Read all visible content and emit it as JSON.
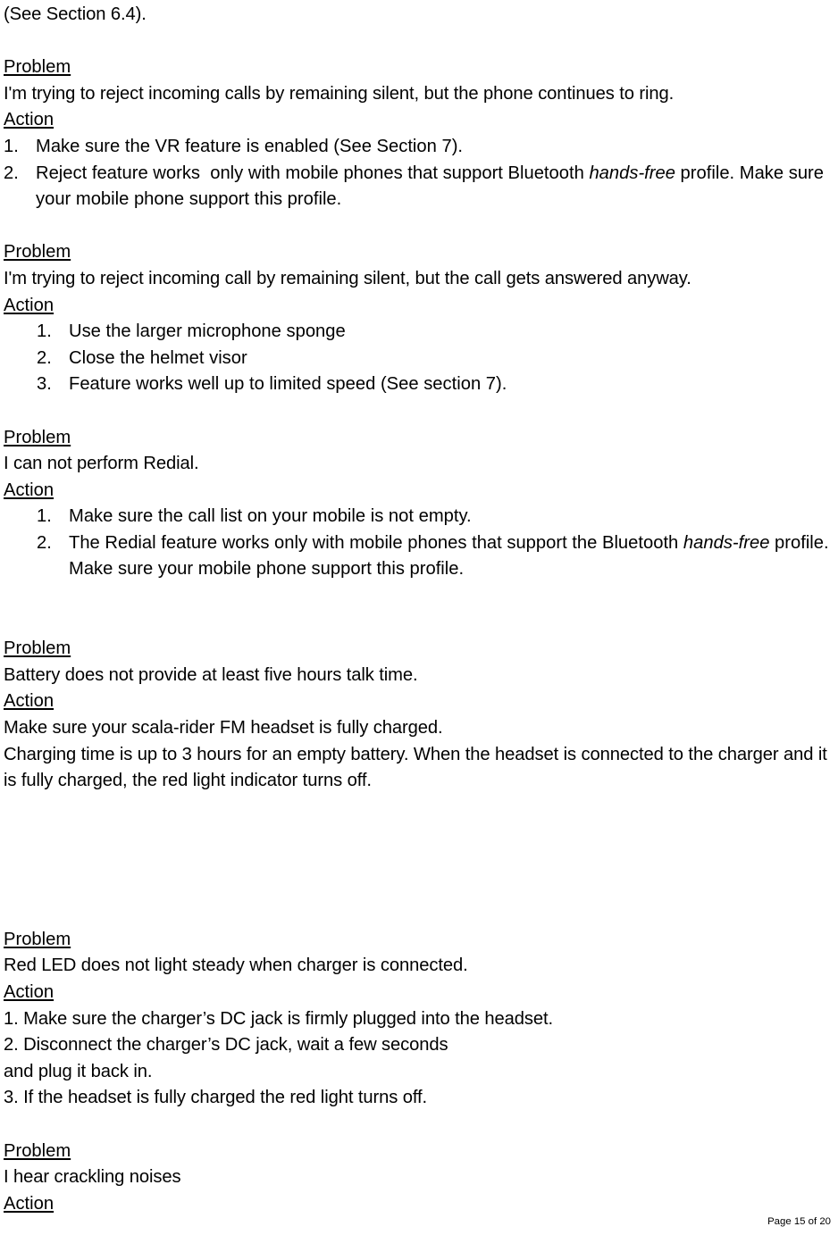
{
  "document": {
    "intro_line": "(See Section 6.4).",
    "labels": {
      "problem": "Problem",
      "action": "Action"
    },
    "sections": [
      {
        "problem_label": "Problem",
        "problem_text": "I'm trying to reject incoming calls by remaining silent, but the phone continues to ring.",
        "action_label": "Action",
        "items": [
          {
            "num": "1.",
            "text_before": "Make sure the VR feature is enabled (See Section 7).",
            "italic": "",
            "text_after": ""
          },
          {
            "num": "2.",
            "text_before": "Reject feature works  only with mobile phones that support Bluetooth ",
            "italic": "hands-free",
            "text_after": " profile. Make sure your mobile phone support this profile."
          }
        ]
      },
      {
        "problem_label": "Problem",
        "problem_text": "I'm trying to reject incoming call by remaining silent, but the call gets answered anyway.",
        "action_label": "Action",
        "items": [
          {
            "num": "1.",
            "text_before": "Use the larger microphone sponge",
            "italic": "",
            "text_after": ""
          },
          {
            "num": "2.",
            "text_before": "Close the helmet visor",
            "italic": "",
            "text_after": ""
          },
          {
            "num": "3.",
            "text_before": "Feature works well up to limited speed (See section 7).",
            "italic": "",
            "text_after": ""
          }
        ]
      },
      {
        "problem_label": "Problem",
        "problem_text": "I can not perform Redial.",
        "action_label": "Action",
        "items": [
          {
            "num": "1.",
            "text_before": "Make sure the call list on your mobile is not empty.",
            "italic": "",
            "text_after": ""
          },
          {
            "num": "2.",
            "text_before": "The Redial feature works only with mobile phones that support the Bluetooth ",
            "italic": "hands-free",
            "text_after": " profile. Make sure your mobile phone support this profile."
          }
        ]
      },
      {
        "problem_label": "Problem",
        "problem_text": "Battery does not provide at least five hours talk time.",
        "action_label": "Action",
        "action_lines": [
          "Make sure your scala-rider FM headset is fully charged.",
          "Charging time is up to 3 hours for an empty battery. When the headset is connected to the charger and it is fully charged, the red light indicator turns off."
        ]
      },
      {
        "problem_label": "Problem",
        "problem_text": "Red LED does not light steady when charger is connected.",
        "action_label": "Action",
        "action_lines": [
          "1. Make sure the charger’s DC jack is firmly plugged into the headset.",
          "2. Disconnect the charger’s DC jack, wait a few seconds",
          "and plug it back in.",
          "3. If the headset is fully charged the red light turns off."
        ]
      },
      {
        "problem_label": "Problem",
        "problem_text": "I hear crackling noises",
        "action_label": "Action",
        "action_lines": []
      }
    ],
    "footer": {
      "page_text": "Page 15 of 20"
    }
  }
}
